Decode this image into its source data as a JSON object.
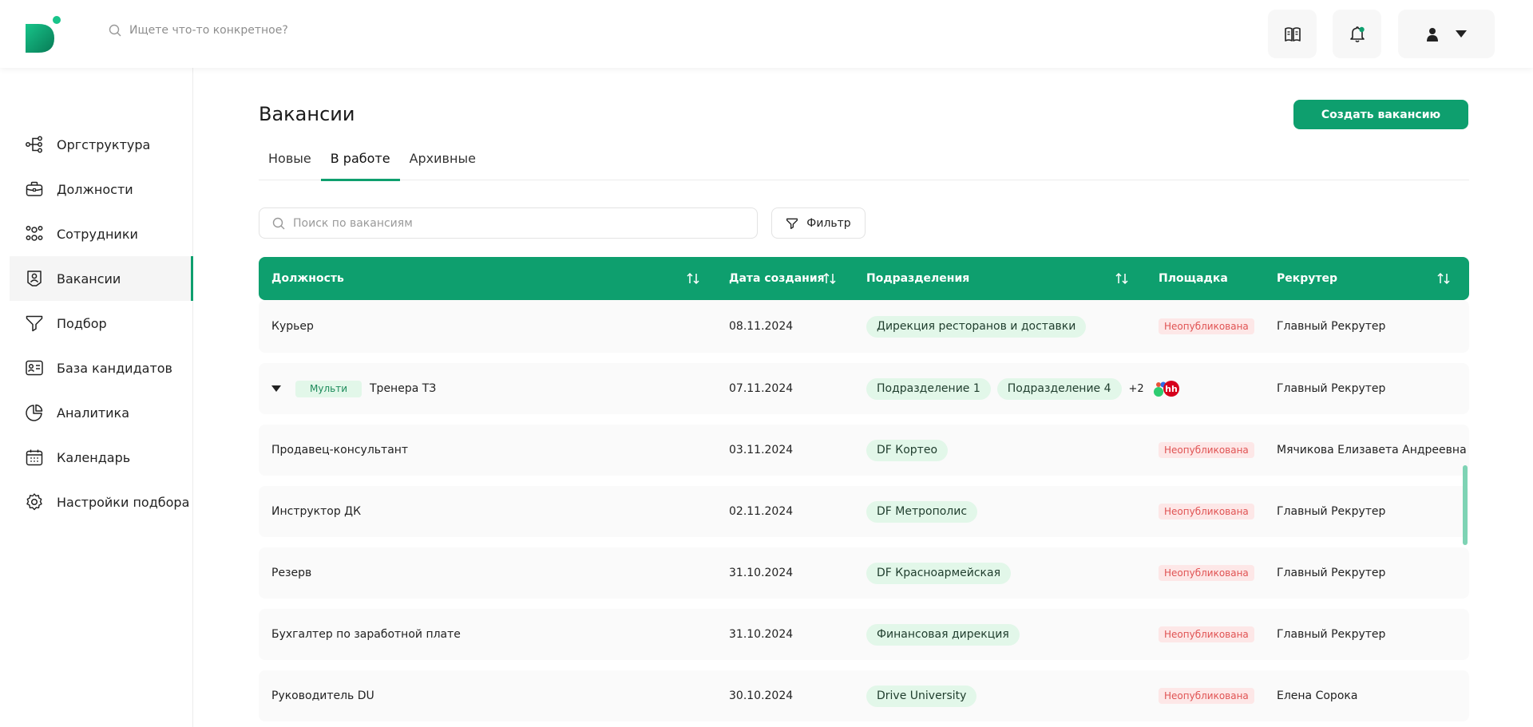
{
  "colors": {
    "accent": "#0e9f6e",
    "pill_bg": "#e2f7e9",
    "badge_bg": "#fde7e7",
    "badge_text": "#e05353"
  },
  "header": {
    "search_placeholder": "Ищете что-то конкретное?",
    "icons": [
      "book-icon",
      "bell-icon",
      "user-icon",
      "chevron-down-icon"
    ]
  },
  "sidebar": {
    "items": [
      {
        "label": "Оргструктура",
        "icon": "org-structure-icon"
      },
      {
        "label": "Должности",
        "icon": "briefcase-icon"
      },
      {
        "label": "Сотрудники",
        "icon": "people-icon"
      },
      {
        "label": "Вакансии",
        "icon": "vacancy-icon",
        "active": true
      },
      {
        "label": "Подбор",
        "icon": "funnel-icon"
      },
      {
        "label": "База кандидатов",
        "icon": "id-card-icon"
      },
      {
        "label": "Аналитика",
        "icon": "pie-chart-icon"
      },
      {
        "label": "Календарь",
        "icon": "calendar-icon"
      },
      {
        "label": "Настройки подбора",
        "icon": "gear-icon"
      }
    ]
  },
  "page": {
    "title": "Вакансии",
    "create_button": "Создать вакансию",
    "tabs": [
      "Новые",
      "В работе",
      "Архивные"
    ],
    "active_tab": "В работе",
    "search_placeholder": "Поиск по вакансиям",
    "filter_label": "Фильтр"
  },
  "table": {
    "columns": [
      "Должность",
      "Дата создания",
      "Подразделения",
      "Площадка",
      "Рекрутер"
    ],
    "rows": [
      {
        "position": "Курьер",
        "date": "08.11.2024",
        "departments": [
          "Дирекция ресторанов и доставки"
        ],
        "platform": "Неопубликована",
        "recruiter": "Главный Рекрутер"
      },
      {
        "tag": "Мульти",
        "position": "Тренера ТЗ",
        "date": "07.11.2024",
        "departments": [
          "Подразделение 1",
          "Подразделение 4"
        ],
        "more": "+2",
        "platform_logo": "hh",
        "recruiter": "Главный Рекрутер"
      },
      {
        "position": "Продавец-консультант",
        "date": "03.11.2024",
        "departments": [
          "DF Кортео"
        ],
        "platform": "Неопубликована",
        "recruiter": "Мячикова Елизавета Андреевна"
      },
      {
        "position": "Инструктор ДК",
        "date": "02.11.2024",
        "departments": [
          "DF Метрополис"
        ],
        "platform": "Неопубликована",
        "recruiter": "Главный Рекрутер"
      },
      {
        "position": "Резерв",
        "date": "31.10.2024",
        "departments": [
          "DF Красноармейская"
        ],
        "platform": "Неопубликована",
        "recruiter": "Главный Рекрутер"
      },
      {
        "position": "Бухгалтер по заработной плате",
        "date": "31.10.2024",
        "departments": [
          "Финансовая дирекция"
        ],
        "platform": "Неопубликована",
        "recruiter": "Главный Рекрутер"
      },
      {
        "position": "Руководитель DU",
        "date": "30.10.2024",
        "departments": [
          "Drive University"
        ],
        "platform": "Неопубликована",
        "recruiter": "Елена Сорока"
      }
    ]
  }
}
